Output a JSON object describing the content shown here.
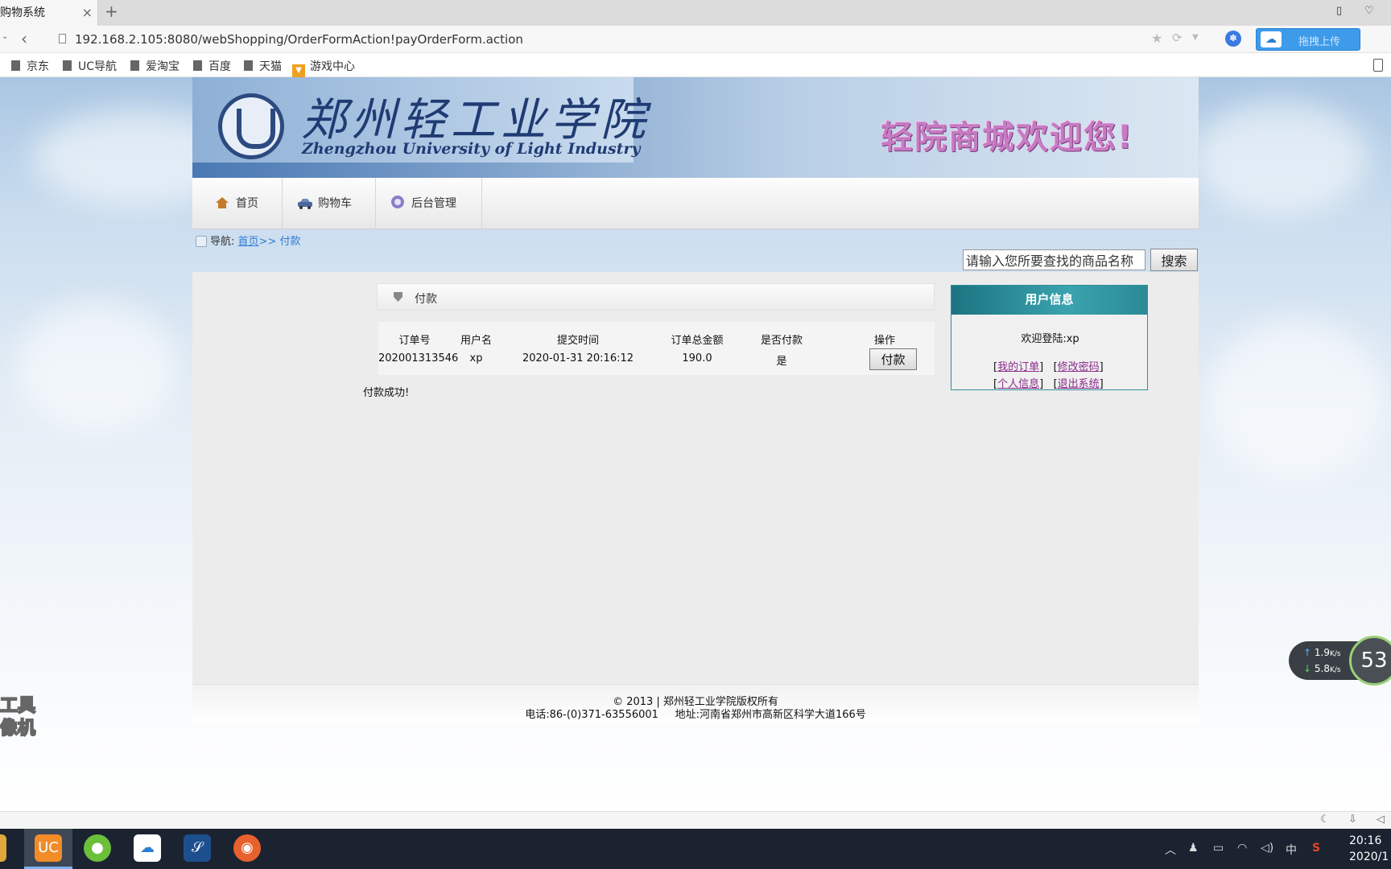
{
  "browser": {
    "tab_title": "购物系统",
    "tab_close": "×",
    "new_tab": "+",
    "url": "192.168.2.105:8080/webShopping/OrderFormAction!payOrderForm.action",
    "upload_label": "拖拽上传"
  },
  "bookmarks": [
    {
      "label": "京东",
      "icon": "folder-icon"
    },
    {
      "label": "UC导航",
      "icon": "folder-icon"
    },
    {
      "label": "爱淘宝",
      "icon": "folder-icon"
    },
    {
      "label": "百度",
      "icon": "folder-icon"
    },
    {
      "label": "天猫",
      "icon": "folder-icon"
    },
    {
      "label": "游戏中心",
      "icon": "game-icon"
    }
  ],
  "banner": {
    "school_name_cn": "郑州轻工业学院",
    "school_name_en": "Zhengzhou University of Light Industry",
    "welcome": "轻院商城欢迎您!"
  },
  "nav": {
    "items": [
      {
        "label": "首页",
        "icon": "home-icon"
      },
      {
        "label": "购物车",
        "icon": "car-icon"
      },
      {
        "label": "后台管理",
        "icon": "admin-icon"
      }
    ]
  },
  "breadcrumb": {
    "prefix": "导航:",
    "home": "首页",
    "sep": ">>",
    "current": "付款"
  },
  "search": {
    "value": "请输入您所要查找的商品名称",
    "button": "搜索"
  },
  "payment": {
    "section_title": "付款",
    "headers": [
      "订单号",
      "用户名",
      "提交时间",
      "订单总金额",
      "是否付款",
      "操作"
    ],
    "row": {
      "order_no": "202001313546",
      "username": "xp",
      "submit_time": "2020-01-31 20:16:12",
      "total": "190.0",
      "paid": "是",
      "action": "付款"
    },
    "result": "付款成功!"
  },
  "user_info": {
    "title": "用户信息",
    "welcome": "欢迎登陆:xp",
    "links": {
      "orders": "我的订单",
      "change_password": "修改密码",
      "profile": "个人信息",
      "logout": "退出系统"
    }
  },
  "footer": {
    "copyright": "© 2013 | 郑州轻工业学院版权所有",
    "contact": "电话:86-(0)371-63556001     地址:河南省郑州市高新区科学大道166号"
  },
  "watermark": {
    "line1": "工具",
    "line2": "像机"
  },
  "network_monitor": {
    "upload": "1.9",
    "download": "5.8",
    "unit": "K/s",
    "gauge": "53"
  },
  "taskbar": {
    "ime": "中",
    "time": "20:16",
    "date": "2020/1"
  },
  "colors": {
    "link": "#2e7cd6",
    "user_link": "#8a2b8a",
    "user_box_header": "#1c7481",
    "welcome_text": "#c77bc3"
  }
}
